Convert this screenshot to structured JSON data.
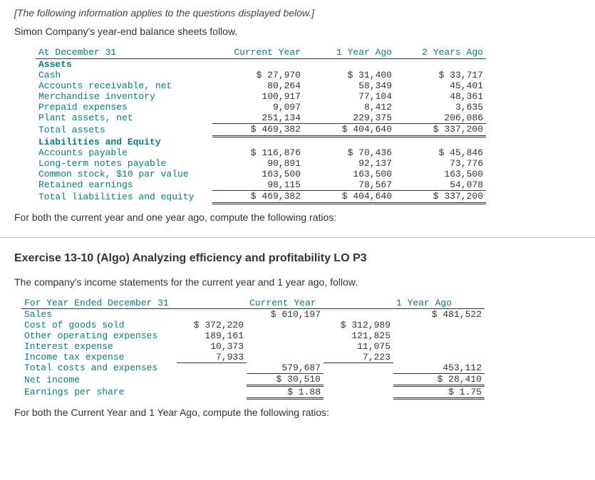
{
  "intro": {
    "italic_note": "[The following information applies to the questions displayed below.]",
    "lead": "Simon Company's year-end balance sheets follow."
  },
  "bs": {
    "header": {
      "date": "At December 31",
      "c1": "Current Year",
      "c2": "1 Year Ago",
      "c3": "2 Years Ago"
    },
    "assets_label": "Assets",
    "rows_assets": [
      {
        "label": "Cash",
        "c1": "$ 27,970",
        "c2": "$ 31,400",
        "c3": "$ 33,717"
      },
      {
        "label": "Accounts receivable, net",
        "c1": "80,264",
        "c2": "58,349",
        "c3": "45,401"
      },
      {
        "label": "Merchandise inventory",
        "c1": "100,917",
        "c2": "77,104",
        "c3": "48,361"
      },
      {
        "label": "Prepaid expenses",
        "c1": "9,097",
        "c2": "8,412",
        "c3": "3,635"
      },
      {
        "label": "Plant assets, net",
        "c1": "251,134",
        "c2": "229,375",
        "c3": "206,086"
      }
    ],
    "total_assets": {
      "label": "Total assets",
      "c1": "$ 469,382",
      "c2": "$ 404,640",
      "c3": "$ 337,200"
    },
    "liab_label": "Liabilities and Equity",
    "rows_liab": [
      {
        "label": "Accounts payable",
        "c1": "$ 116,876",
        "c2": "$ 70,436",
        "c3": "$ 45,846"
      },
      {
        "label": "Long-term notes payable",
        "c1": "90,891",
        "c2": "92,137",
        "c3": "73,776"
      },
      {
        "label": "Common stock, $10 par value",
        "c1": "163,500",
        "c2": "163,500",
        "c3": "163,500"
      },
      {
        "label": "Retained earnings",
        "c1": "98,115",
        "c2": "78,567",
        "c3": "54,078"
      }
    ],
    "total_liab": {
      "label": "Total liabilities and equity",
      "c1": "$ 469,382",
      "c2": "$ 404,640",
      "c3": "$ 337,200"
    }
  },
  "ratio_note_1": "For both the current year and one year ago, compute the following ratios:",
  "exercise_title": "Exercise 13-10 (Algo) Analyzing efficiency and profitability LO P3",
  "income_lead": "The company's income statements for the current year and 1 year ago, follow.",
  "is": {
    "header": {
      "date": "For Year Ended December 31",
      "c1": "Current Year",
      "c2": "1 Year Ago"
    },
    "sales": {
      "label": "Sales",
      "cy": "$ 610,197",
      "py": "$ 481,522"
    },
    "rows": [
      {
        "label": "Cost of goods sold",
        "cy": "$ 372,220",
        "py": "$ 312,989"
      },
      {
        "label": "Other operating expenses",
        "cy": "189,161",
        "py": "121,825"
      },
      {
        "label": "Interest expense",
        "cy": "10,373",
        "py": "11,075"
      },
      {
        "label": "Income tax expense",
        "cy": "7,933",
        "py": "7,223"
      }
    ],
    "total_costs": {
      "label": "Total costs and expenses",
      "cy": "579,687",
      "py": "453,112"
    },
    "net_income": {
      "label": "Net income",
      "cy": "$ 30,510",
      "py": "$ 28,410"
    },
    "eps": {
      "label": "Earnings per share",
      "cy": "$ 1.88",
      "py": "$ 1.75"
    }
  },
  "ratio_note_2": "For both the Current Year and 1 Year Ago, compute the following ratios:"
}
